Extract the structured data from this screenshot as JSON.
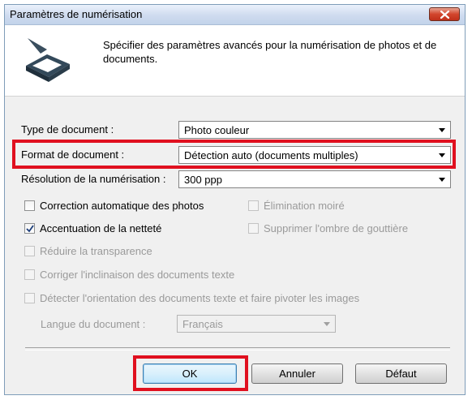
{
  "window": {
    "title": "Paramètres de numérisation"
  },
  "header": {
    "description": "Spécifier des paramètres avancés pour la numérisation de photos et de documents."
  },
  "fields": {
    "doc_type": {
      "label": "Type de document :",
      "value": "Photo couleur"
    },
    "doc_format": {
      "label": "Format de document :",
      "value": "Détection auto (documents multiples)"
    },
    "resolution": {
      "label": "Résolution de la numérisation :",
      "value": "300 ppp"
    },
    "language": {
      "label": "Langue du document :",
      "value": "Français"
    }
  },
  "checkboxes": {
    "auto_photo_fix": {
      "label": "Correction automatique des photos",
      "checked": false
    },
    "descreen": {
      "label": "Élimination moiré",
      "checked": false
    },
    "sharpen": {
      "label": "Accentuation de la netteté",
      "checked": true
    },
    "gutter_shadow": {
      "label": "Supprimer l'ombre de gouttière",
      "checked": false
    },
    "show_through": {
      "label": "Réduire la transparence",
      "checked": false
    },
    "deskew": {
      "label": "Corriger l'inclinaison des documents texte",
      "checked": false
    },
    "orientation": {
      "label": "Détecter l'orientation des documents texte et faire pivoter les images",
      "checked": false
    }
  },
  "buttons": {
    "ok": "OK",
    "cancel": "Annuler",
    "default": "Défaut"
  },
  "colors": {
    "highlight": "#e0101f",
    "close_button": "#d2452c"
  }
}
